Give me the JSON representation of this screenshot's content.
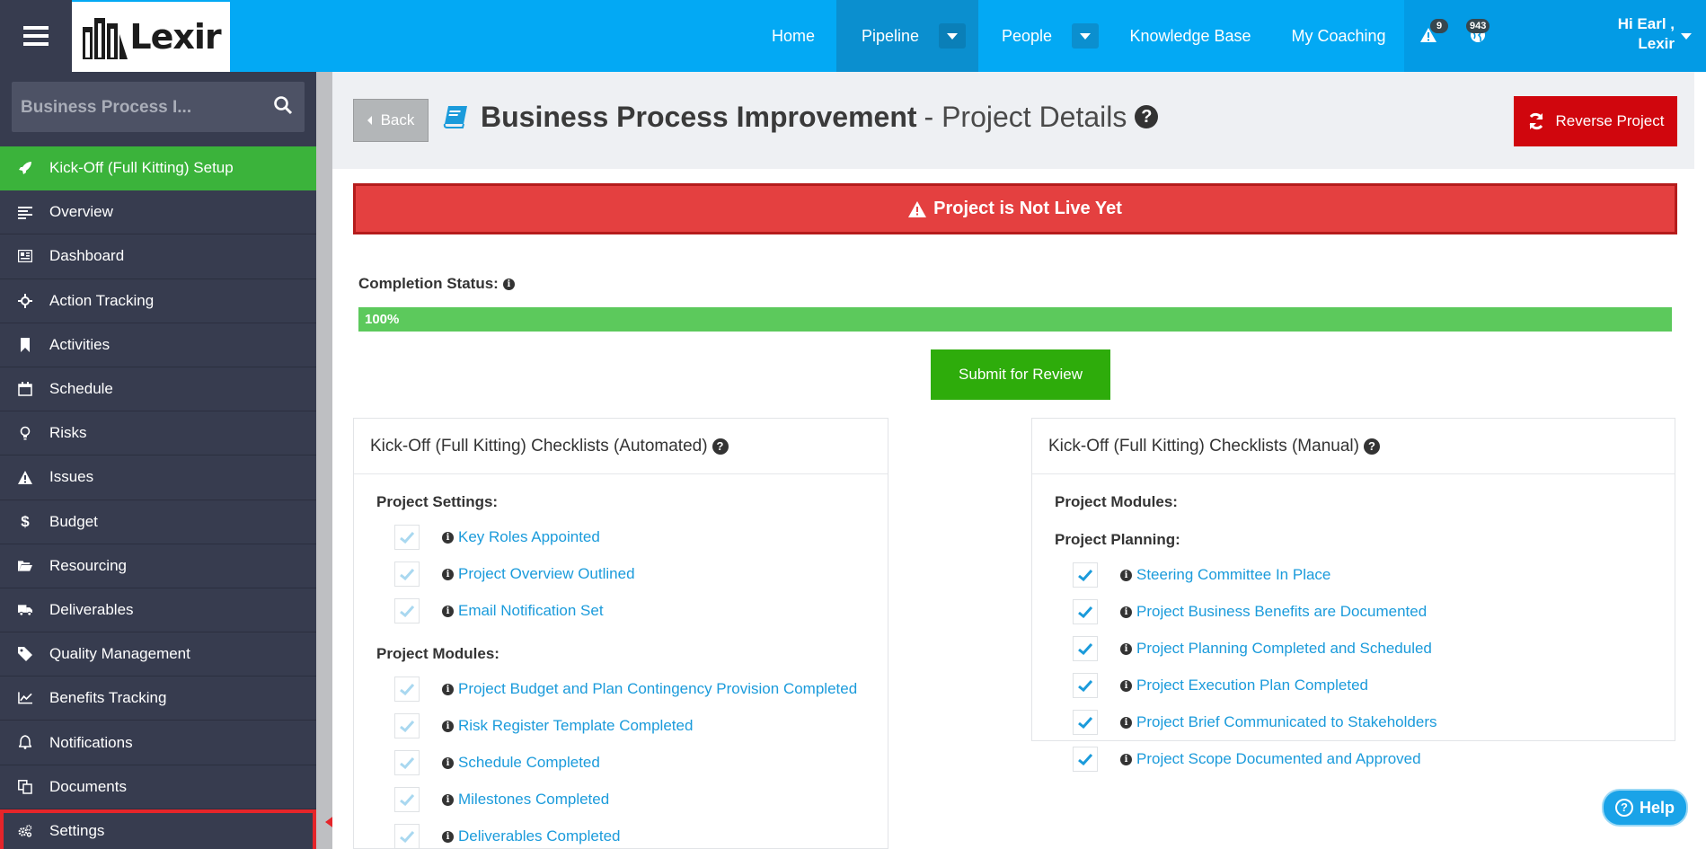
{
  "topbar": {
    "logo_text": "Lexir",
    "nav": {
      "home": "Home",
      "pipeline": "Pipeline",
      "people": "People",
      "knowledge_base": "Knowledge Base",
      "my_coaching": "My Coaching"
    },
    "alerts_count": "9",
    "notifications_count": "943",
    "greeting_line1": "Hi Earl ,",
    "greeting_line2": "Lexir"
  },
  "sidebar": {
    "search_text": "Business Process I...",
    "items": [
      {
        "label": "Kick-Off (Full Kitting) Setup",
        "icon": "rocket-icon"
      },
      {
        "label": "Overview",
        "icon": "align-left-icon"
      },
      {
        "label": "Dashboard",
        "icon": "newspaper-icon"
      },
      {
        "label": "Action Tracking",
        "icon": "crosshair-icon"
      },
      {
        "label": "Activities",
        "icon": "bookmark-icon"
      },
      {
        "label": "Schedule",
        "icon": "calendar-icon"
      },
      {
        "label": "Risks",
        "icon": "lightbulb-icon"
      },
      {
        "label": "Issues",
        "icon": "warning-icon"
      },
      {
        "label": "Budget",
        "icon": "dollar-icon"
      },
      {
        "label": "Resourcing",
        "icon": "folder-open-icon"
      },
      {
        "label": "Deliverables",
        "icon": "truck-icon"
      },
      {
        "label": "Quality Management",
        "icon": "tag-icon"
      },
      {
        "label": "Benefits Tracking",
        "icon": "line-chart-icon"
      },
      {
        "label": "Notifications",
        "icon": "bell-icon"
      },
      {
        "label": "Documents",
        "icon": "files-icon"
      },
      {
        "label": "Settings",
        "icon": "cogs-icon"
      }
    ]
  },
  "header": {
    "back_label": "Back",
    "title_bold": "Business Process Improvement",
    "title_rest": "- Project Details",
    "reverse_label": "Reverse Project"
  },
  "alert": {
    "text": "Project is Not Live Yet",
    "color": "#e44040"
  },
  "completion": {
    "label": "Completion Status:",
    "percent_text": "100%",
    "percent": 100,
    "submit_label": "Submit for Review"
  },
  "automated": {
    "title": "Kick-Off (Full Kitting) Checklists (Automated)",
    "section1": "Project Settings:",
    "settings_items": [
      "Key Roles Appointed",
      "Project Overview Outlined",
      "Email Notification Set"
    ],
    "section2": "Project Modules:",
    "module_items": [
      "Project Budget and Plan Contingency Provision Completed",
      "Risk Register Template Completed",
      "Schedule Completed",
      "Milestones Completed",
      "Deliverables Completed"
    ]
  },
  "manual": {
    "title": "Kick-Off (Full Kitting) Checklists (Manual)",
    "section1": "Project Modules:",
    "section2": "Project Planning:",
    "planning_items": [
      "Steering Committee In Place",
      "Project Business Benefits are Documented",
      "Project Planning Completed and Scheduled",
      "Project Execution Plan Completed",
      "Project Brief Communicated to Stakeholders",
      "Project Scope Documented and Approved"
    ]
  },
  "help_label": "Help"
}
